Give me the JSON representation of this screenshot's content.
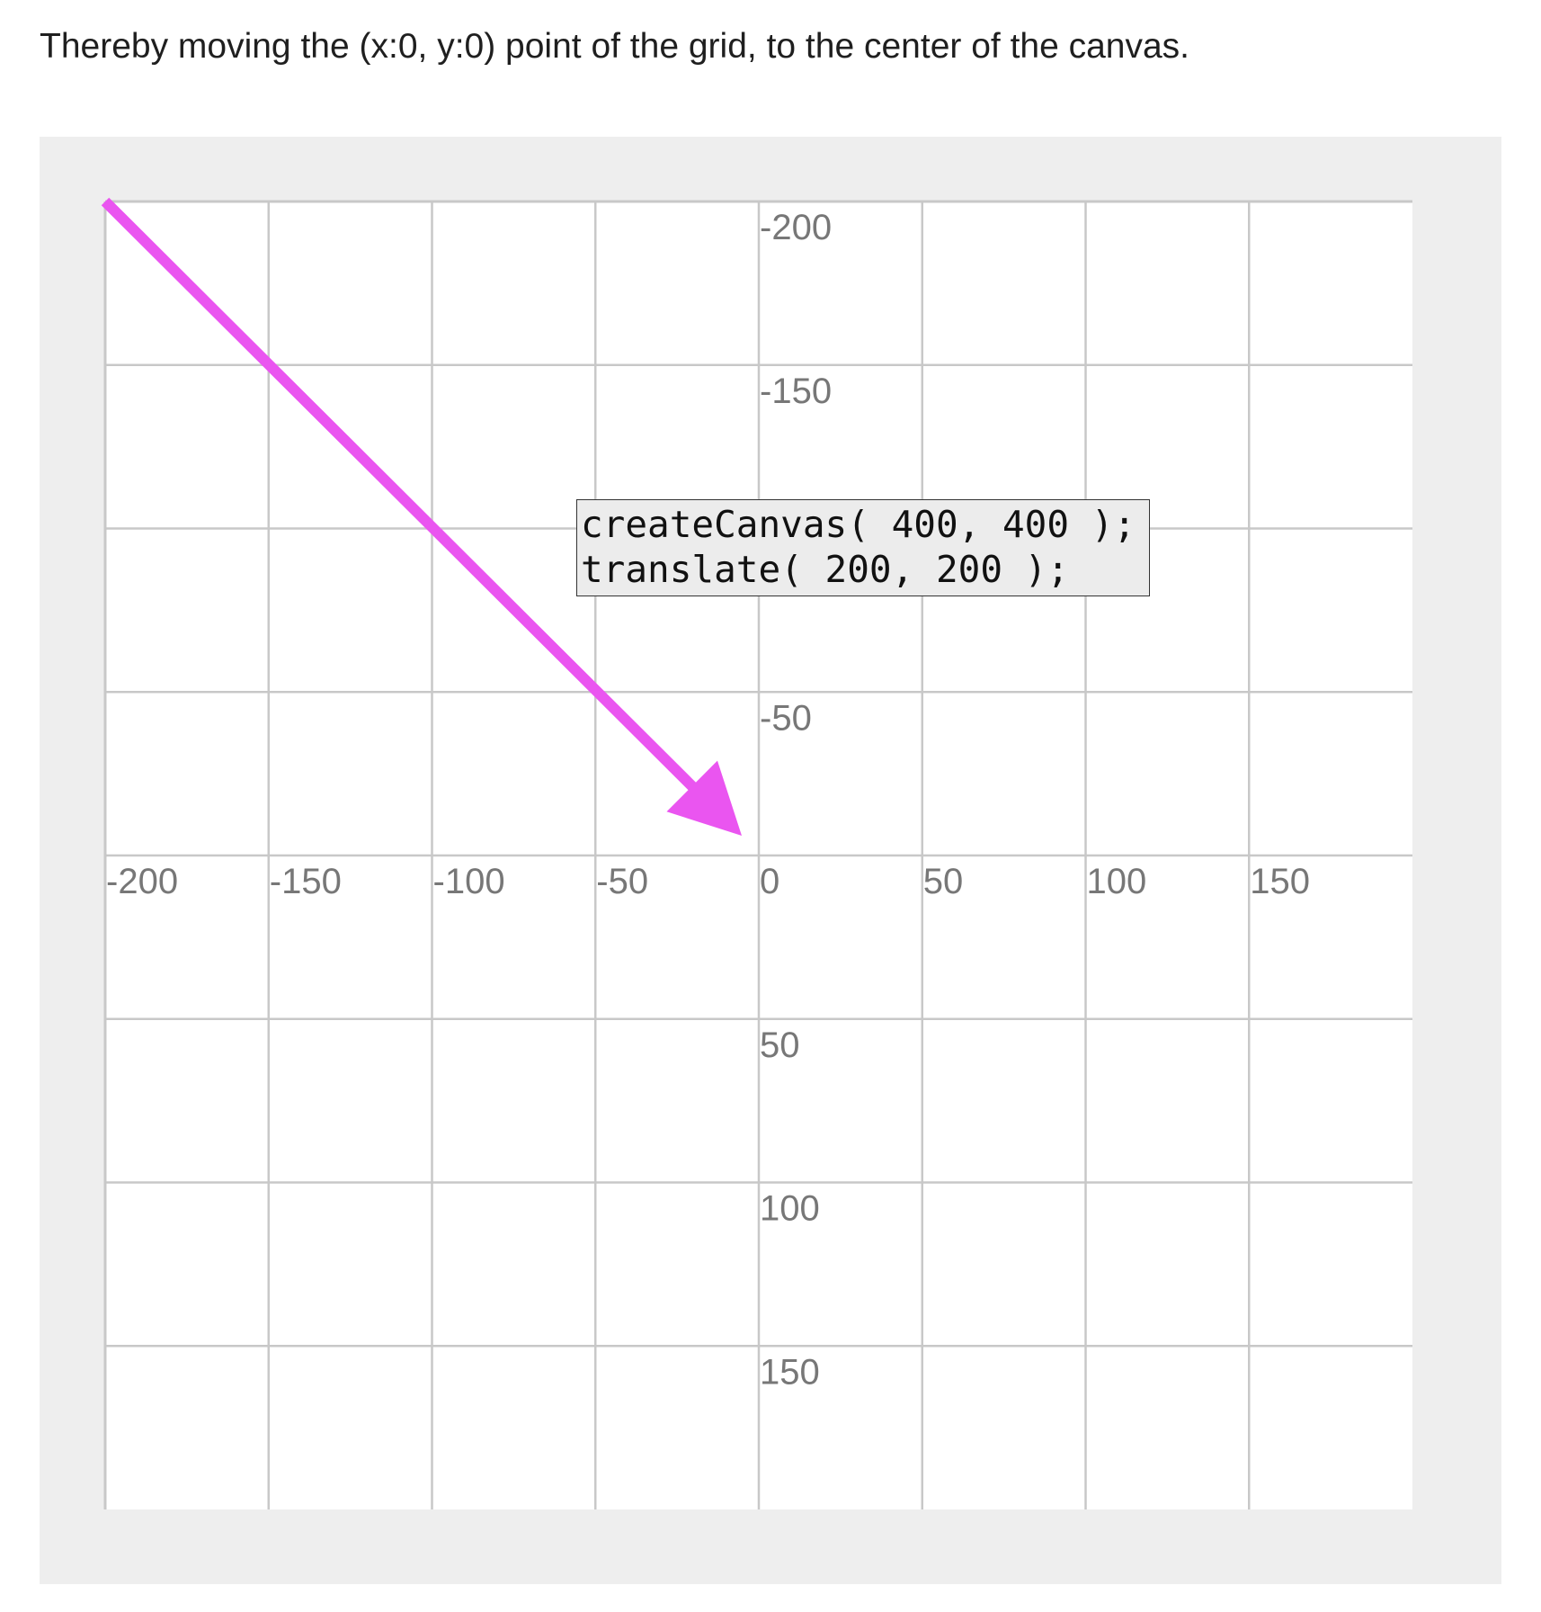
{
  "intro_text": "Thereby moving the (x:0, y:0) point of the grid, to the center of the canvas.",
  "code": {
    "lines": [
      "createCanvas( 400, 400 );",
      "translate( 200, 200 );"
    ]
  },
  "grid": {
    "x_tick_labels": [
      "-200",
      "-150",
      "-100",
      "-50",
      "0",
      "50",
      "100",
      "150"
    ],
    "y_tick_labels": [
      "-200",
      "-150",
      "",
      "-50",
      "",
      "50",
      "100",
      "150"
    ]
  },
  "arrow": {
    "from": [
      -200,
      -200
    ],
    "to": [
      0,
      0
    ],
    "color": "#ea55f0"
  },
  "colors": {
    "panel_background": "#eeeeee",
    "grid_line": "#c8c8c8",
    "tick_label": "#777777",
    "code_background": "#ececec"
  }
}
